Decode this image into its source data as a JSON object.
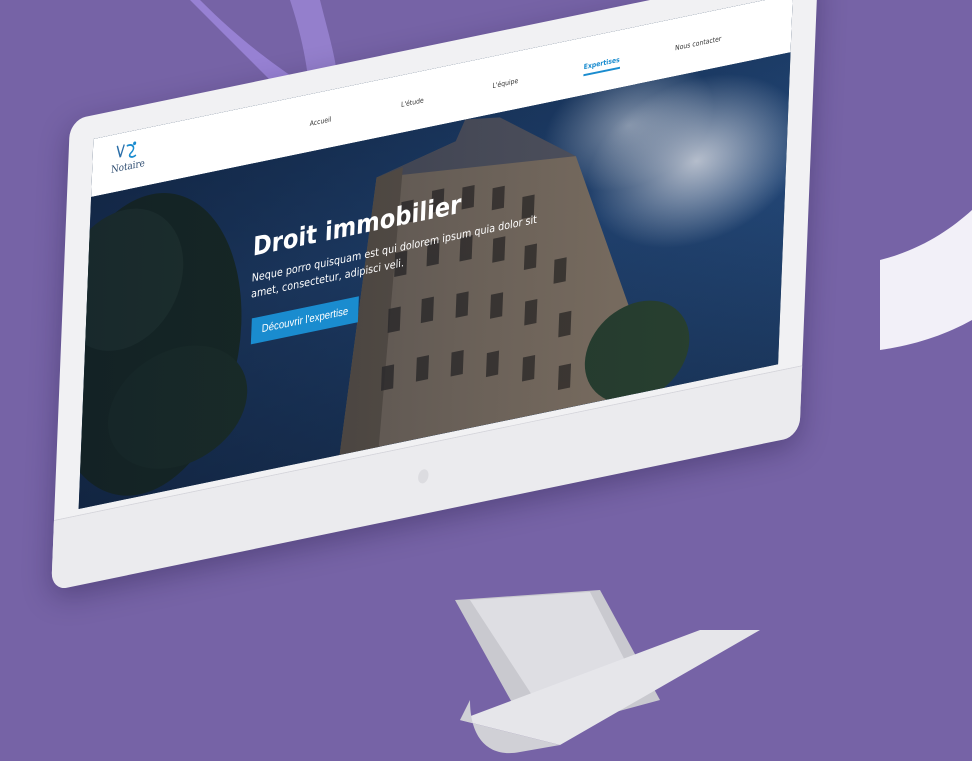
{
  "colors": {
    "background": "#7663a6",
    "accent": "#1a8ccf",
    "monitor": "#f1f1f3"
  },
  "site": {
    "logo_text": "Notaire",
    "logo_icon": "notaire-logo-icon"
  },
  "nav": {
    "items": [
      {
        "label": "Accueil"
      },
      {
        "label": "L'étude"
      },
      {
        "label": "L'équipe"
      },
      {
        "label": "Expertises",
        "active": true
      },
      {
        "label": "Nous contacter"
      }
    ]
  },
  "hero": {
    "title": "Droit immobilier",
    "text": "Neque porro quisquam est qui dolorem ipsum quia dolor sit amet, consectetur, adipisci veli.",
    "button_label": "Découvrir l'expertise"
  }
}
